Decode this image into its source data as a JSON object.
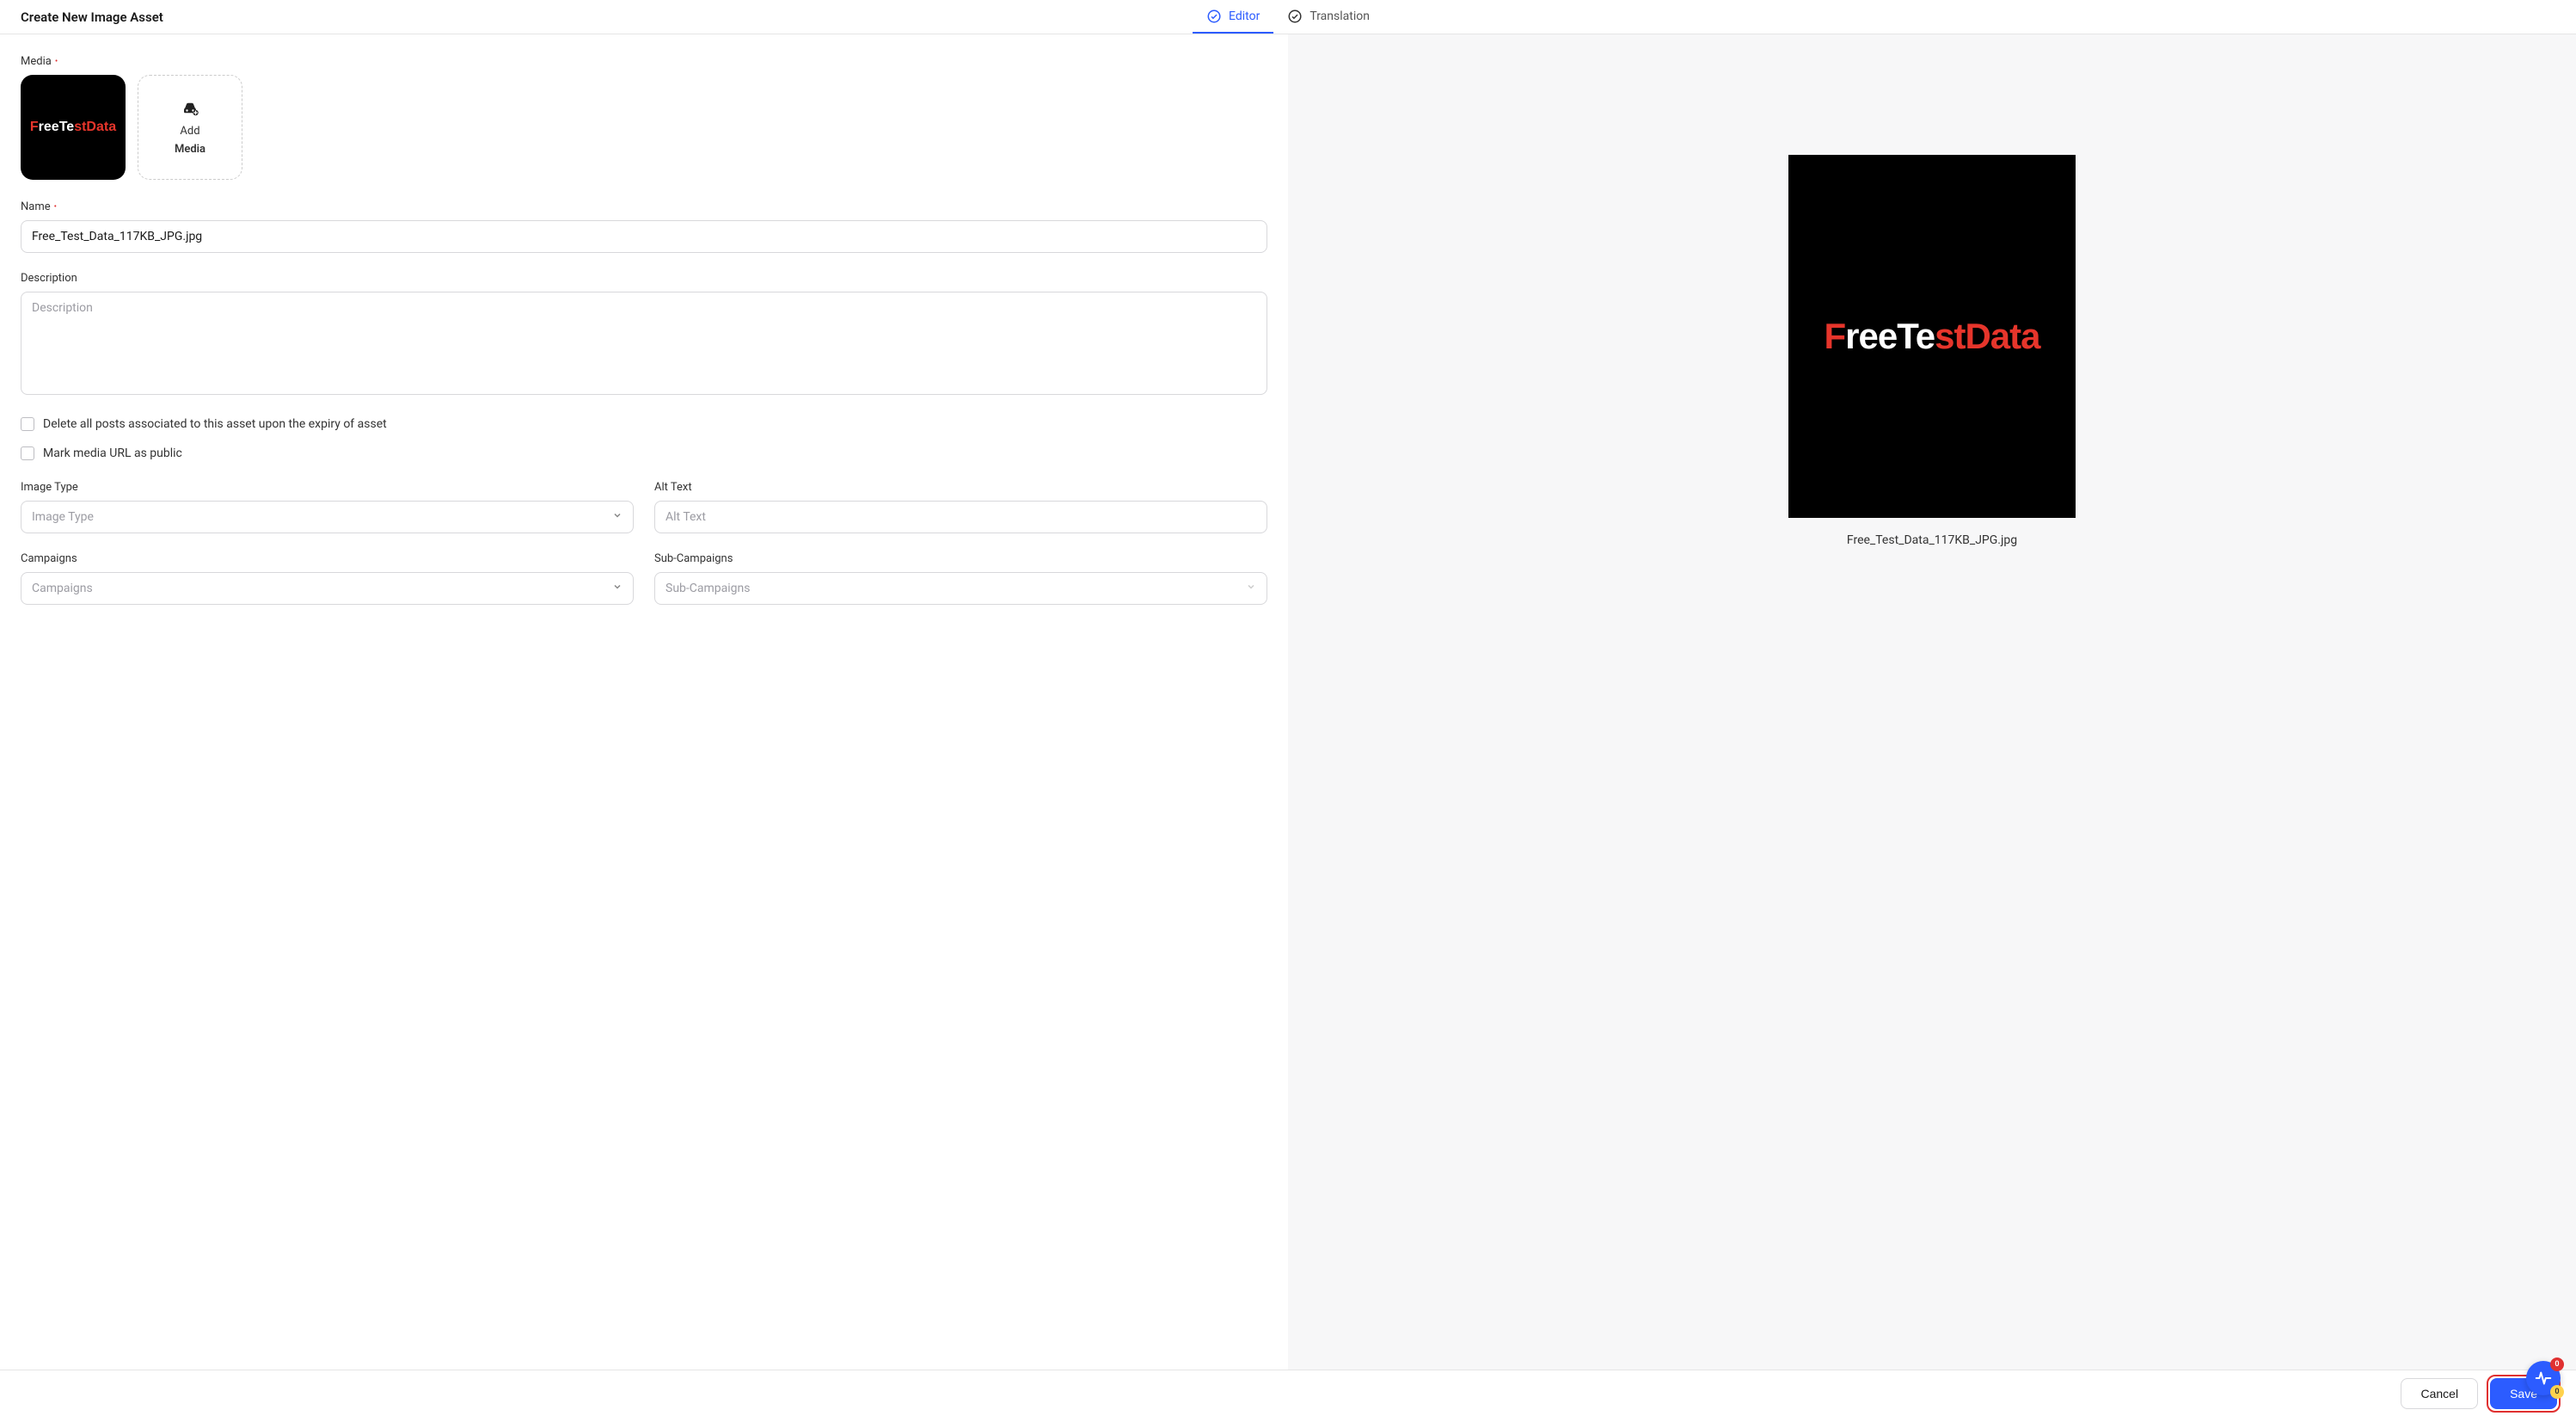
{
  "header": {
    "title": "Create New Image Asset",
    "tabs": [
      {
        "label": "Editor",
        "active": true
      },
      {
        "label": "Translation",
        "active": false
      }
    ]
  },
  "form": {
    "media": {
      "label": "Media",
      "add_line1": "Add",
      "add_line2": "Media"
    },
    "name": {
      "label": "Name",
      "value": "Free_Test_Data_117KB_JPG.jpg"
    },
    "description": {
      "label": "Description",
      "placeholder": "Description",
      "value": ""
    },
    "checkboxes": {
      "delete_posts": "Delete all posts associated to this asset upon the expiry of asset",
      "mark_public": "Mark media URL as public"
    },
    "image_type": {
      "label": "Image Type",
      "placeholder": "Image Type"
    },
    "alt_text": {
      "label": "Alt Text",
      "placeholder": "Alt Text",
      "value": ""
    },
    "campaigns": {
      "label": "Campaigns",
      "placeholder": "Campaigns"
    },
    "sub_campaigns": {
      "label": "Sub-Campaigns",
      "placeholder": "Sub-Campaigns"
    }
  },
  "preview": {
    "caption": "Free_Test_Data_117KB_JPG.jpg"
  },
  "footer": {
    "cancel": "Cancel",
    "save": "Save"
  },
  "fab": {
    "badge_red": "0",
    "badge_yellow": "0"
  }
}
